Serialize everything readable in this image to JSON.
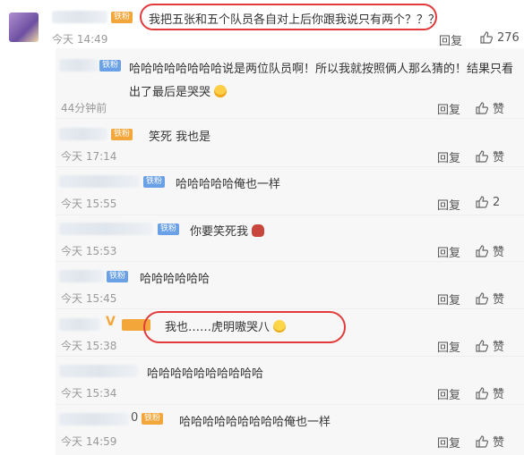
{
  "top_comment": {
    "text": "我把五张和五个队员各自对上后你跟我说只有两个？？？",
    "time": "今天 14:49",
    "reply_label": "回复",
    "likes": "276"
  },
  "replies": [
    {
      "badge": "铁粉",
      "text": "哈哈哈哈哈哈哈哈说是两位队员啊！所以我就按照俩人那么猜的！结果只看出了最后是哭哭",
      "time": "44分钟前",
      "reply_label": "回复",
      "like_label": "赞"
    },
    {
      "badge": "铁粉",
      "text": "笑死 我也是",
      "time": "今天 17:14",
      "reply_label": "回复",
      "like_label": "赞"
    },
    {
      "badge": "铁粉",
      "text": "哈哈哈哈哈俺也一样",
      "time": "今天 15:55",
      "reply_label": "回复",
      "likes": "2"
    },
    {
      "badge": "铁粉",
      "text": "你要笑死我",
      "time": "今天 15:53",
      "reply_label": "回复",
      "like_label": "赞"
    },
    {
      "badge": "铁粉",
      "text": "哈哈哈哈哈哈",
      "time": "今天 15:45",
      "reply_label": "回复",
      "like_label": "赞"
    },
    {
      "badge": "V",
      "text": "我也……虎明嗷哭八",
      "time": "今天 15:38",
      "reply_label": "回复",
      "like_label": "赞"
    },
    {
      "text": "哈哈哈哈哈哈哈哈哈哈",
      "time": "今天 15:34",
      "reply_label": "回复",
      "like_label": "赞"
    },
    {
      "name_suffix": "0",
      "badge": "铁粉",
      "text": "哈哈哈哈哈哈哈哈哈俺也一样",
      "time": "今天 14:59",
      "reply_label": "回复",
      "like_label": "赞"
    }
  ],
  "colors": {
    "badge_blue": "#6aa0e6",
    "badge_gold": "#f3a63a",
    "highlight_red": "#e23a3a",
    "reply_bg": "#f7f7f7"
  }
}
